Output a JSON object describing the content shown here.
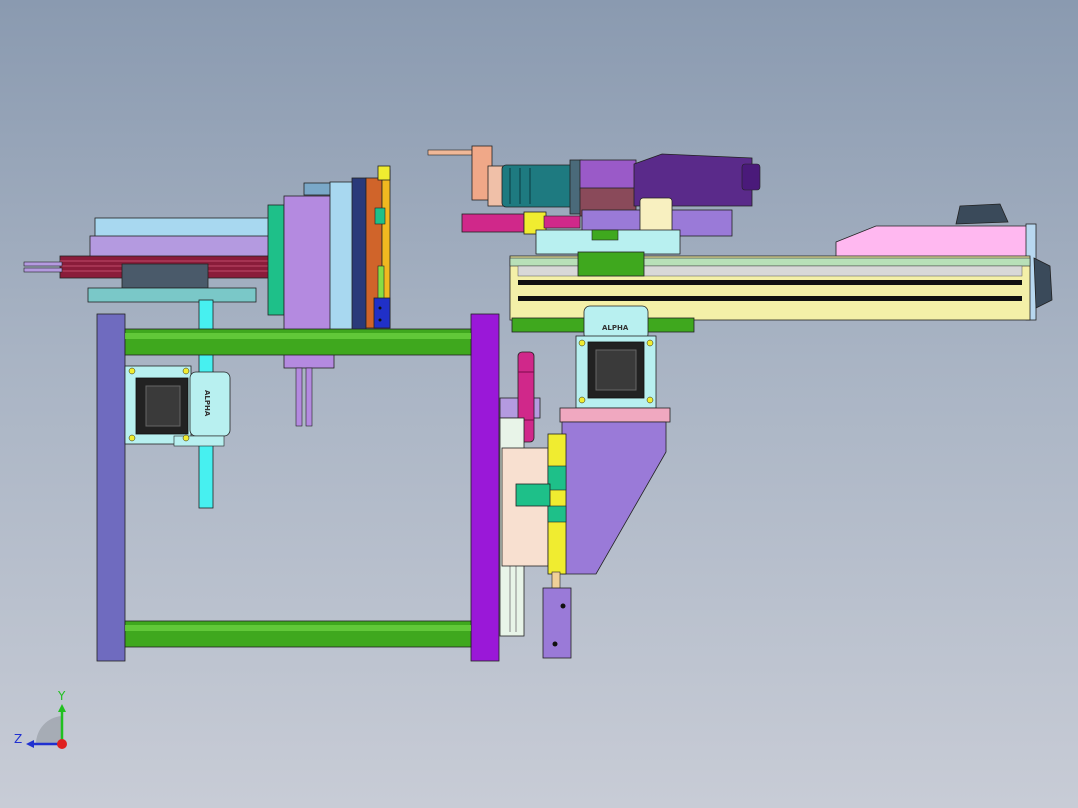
{
  "view": {
    "title": "",
    "colors": {
      "frame_post": "#6f6bbf",
      "frame_post_right": "#9a18d8",
      "rail": "#3fa81e",
      "cyan_bar": "#47f0f0",
      "slide_body": "#f4f0a8",
      "cover": "#ffb8f0",
      "bracket": "#9a7ad8",
      "motor": "#5a2a8a",
      "teal_block": "#1ec089",
      "yellow": "#f0ec30",
      "magenta": "#d0288a"
    }
  },
  "motor_labels": {
    "left": "ALPHA",
    "right": "ALPHA"
  },
  "triad": {
    "y_label": "Y",
    "z_label": "Z",
    "icon": "coordinate-triad-icon"
  }
}
